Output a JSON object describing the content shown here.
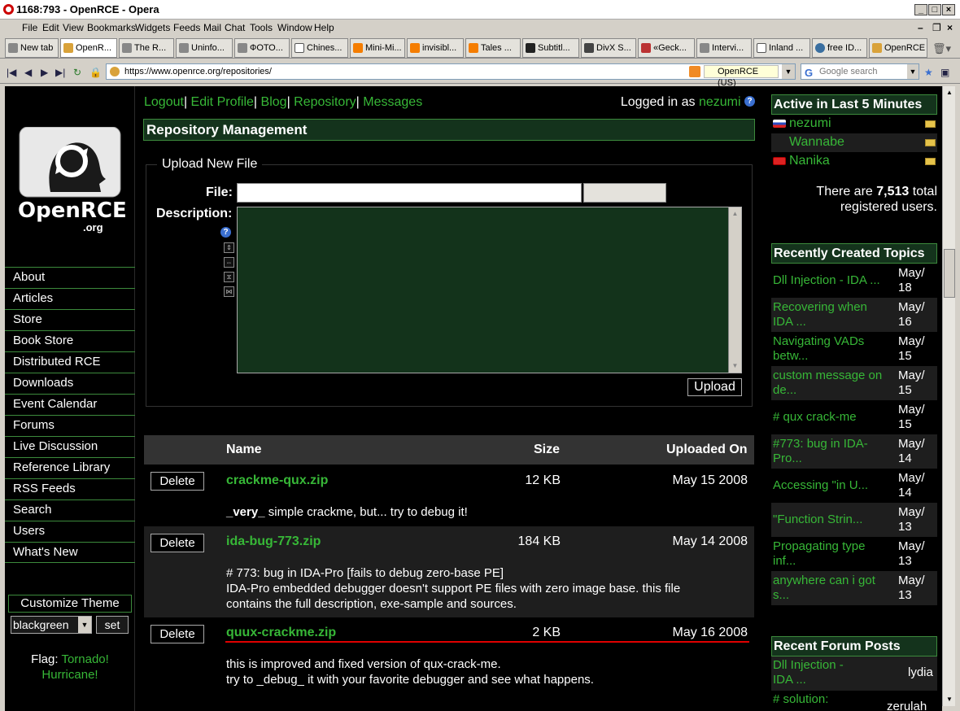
{
  "window": {
    "title": "1168:793 - OpenRCE - Opera"
  },
  "menu": [
    "File",
    "Edit",
    "View",
    "Bookmarks",
    "Widgets",
    "Feeds",
    "Mail",
    "Chat",
    "Tools",
    "Window",
    "Help"
  ],
  "tabs": [
    "New tab",
    "OpenR...",
    "The R...",
    "Uninfo...",
    "ФОТО...",
    "Chines...",
    "Mini-Mi...",
    "invisibl...",
    "Tales ...",
    "Subtitl...",
    "DivX S...",
    "«Geck...",
    "Intervi...",
    "Inland ...",
    "free ID...",
    "OpenRCE"
  ],
  "address": {
    "url": "https://www.openrce.org/repositories/",
    "site_badge": "OpenRCE (US)",
    "search_placeholder": "Google search"
  },
  "nav": {
    "logout": "Logout",
    "edit_profile": "Edit Profile",
    "blog": "Blog",
    "repository": "Repository",
    "messages": "Messages",
    "logged_in_prefix": "Logged in as",
    "username": "nezumi"
  },
  "logo": {
    "name": "OpenRCE",
    "suffix": ".org"
  },
  "sidebar": {
    "items": [
      "About",
      "Articles",
      "Store",
      "Book Store",
      "Distributed RCE",
      "Downloads",
      "Event Calendar",
      "Forums",
      "Live Discussion",
      "Reference Library",
      "RSS Feeds",
      "Search",
      "Users",
      "What's New"
    ],
    "customize_label": "Customize Theme",
    "theme_value": "blackgreen",
    "set_label": "set",
    "flag_prefix": "Flag:",
    "flag_value_1": "Tornado!",
    "flag_value_2": "Hurricane!"
  },
  "main": {
    "section_title": "Repository Management",
    "upload_legend": "Upload New File",
    "file_label": "File:",
    "description_label": "Description:",
    "upload_button": "Upload",
    "columns": {
      "name": "Name",
      "size": "Size",
      "uploaded": "Uploaded On"
    },
    "delete_label": "Delete",
    "files": [
      {
        "name": "crackme-qux.zip",
        "size": "12 KB",
        "date": "May 15 2008",
        "desc_bold": "_very_",
        "desc_rest": " simple crackme, but... try to debug it!",
        "desc_2": "",
        "desc_3": ""
      },
      {
        "name": "ida-bug-773.zip",
        "size": "184 KB",
        "date": "May 14 2008",
        "desc_bold": "",
        "desc_rest": "# 773: bug in IDA-Pro [fails to debug zero-base PE]",
        "desc_2": "IDA-Pro embedded debugger doesn't support PE files with zero image base. this file",
        "desc_3": "contains the full description, exe-sample and sources."
      },
      {
        "name": "quux-crackme.zip",
        "size": "2 KB",
        "date": "May 16 2008",
        "desc_bold": "",
        "desc_rest": "this is improved and fixed version of qux-crack-me.",
        "desc_2": "try to _debug_ it with your favorite debugger and see what happens.",
        "desc_3": ""
      }
    ]
  },
  "right": {
    "active_title": "Active in Last 5 Minutes",
    "users": [
      "nezumi",
      "Wannabe",
      "Nanika"
    ],
    "stats_prefix": "There are",
    "stats_count": "7,513",
    "stats_suffix_1": "total",
    "stats_suffix_2": "registered users.",
    "topics_title": "Recently Created Topics",
    "topics": [
      {
        "t1": "Dll Injection - IDA ...",
        "t2": "",
        "d1": "May/",
        "d2": "18"
      },
      {
        "t1": "Recovering when",
        "t2": "IDA ...",
        "d1": "May/",
        "d2": "16"
      },
      {
        "t1": "Navigating VADs",
        "t2": "betw...",
        "d1": "May/",
        "d2": "15"
      },
      {
        "t1": "custom message on",
        "t2": "de...",
        "d1": "May/",
        "d2": "15"
      },
      {
        "t1": "# qux crack-me",
        "t2": "",
        "d1": "May/",
        "d2": "15"
      },
      {
        "t1": "#773: bug in IDA-",
        "t2": "Pro...",
        "d1": "May/",
        "d2": "14"
      },
      {
        "t1": "Accessing \"in U...",
        "t2": "",
        "d1": "May/",
        "d2": "14"
      },
      {
        "t1": "\"Function Strin...",
        "t2": "",
        "d1": "May/",
        "d2": "13"
      },
      {
        "t1": "Propagating type",
        "t2": "inf...",
        "d1": "May/",
        "d2": "13"
      },
      {
        "t1": "anywhere can i got",
        "t2": "s...",
        "d1": "May/",
        "d2": "13"
      }
    ],
    "posts_title": "Recent Forum Posts",
    "posts": [
      {
        "t1": "Dll Injection -",
        "t2": "IDA ...",
        "user": "lydia"
      },
      {
        "t1": "# solution:",
        "t2": "",
        "user": "zerulah"
      }
    ]
  }
}
